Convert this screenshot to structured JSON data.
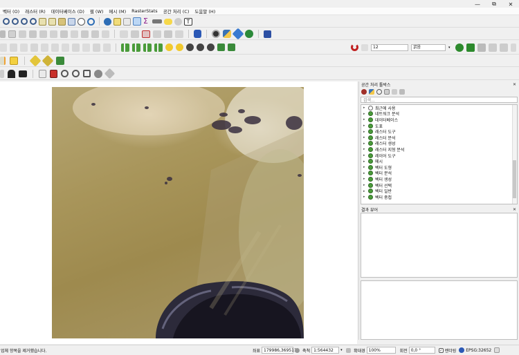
{
  "window": {
    "minimize": "—",
    "maximize": "⧉",
    "close": "✕"
  },
  "menu": [
    "벡터 (O)",
    "래스터 (R)",
    "데이터베이스 (D)",
    "웹 (W)",
    "메시 (M)",
    "RasterStats",
    "공간 처리 (C)",
    "도움말 (H)"
  ],
  "toolbar": {
    "font_size_value": "12",
    "font_style_value": "굵음"
  },
  "panel": {
    "toolbox_title": "공간 처리 툴박스",
    "search_placeholder": "검색...",
    "tree_items": [
      {
        "label": "최근에 사용",
        "icon": "clock-icon"
      },
      {
        "label": "네트워크 분석",
        "icon": "qgis-algorithm-icon"
      },
      {
        "label": "데이터베이스",
        "icon": "qgis-algorithm-icon"
      },
      {
        "label": "도표",
        "icon": "qgis-algorithm-icon"
      },
      {
        "label": "래스터 도구",
        "icon": "qgis-algorithm-icon"
      },
      {
        "label": "래스터 분석",
        "icon": "qgis-algorithm-icon"
      },
      {
        "label": "래스터 생성",
        "icon": "qgis-algorithm-icon"
      },
      {
        "label": "래스터 지형 분석",
        "icon": "qgis-algorithm-icon"
      },
      {
        "label": "레이어 도구",
        "icon": "qgis-algorithm-icon"
      },
      {
        "label": "메시",
        "icon": "qgis-algorithm-icon"
      },
      {
        "label": "벡터 도형",
        "icon": "qgis-algorithm-icon"
      },
      {
        "label": "벡터 분석",
        "icon": "qgis-algorithm-icon"
      },
      {
        "label": "벡터 생성",
        "icon": "qgis-algorithm-icon"
      },
      {
        "label": "벡터 선택",
        "icon": "qgis-algorithm-icon"
      },
      {
        "label": "벡터 일반",
        "icon": "qgis-algorithm-icon"
      },
      {
        "label": "벡터 중첩",
        "icon": "qgis-algorithm-icon"
      }
    ],
    "results_title": "결과 뷰어"
  },
  "status": {
    "message": "업체 항목을 제거했습니다.",
    "coord_label": "좌표",
    "coord_value": "179986,3695111",
    "scale_label": "축척",
    "scale_value": "1:564432",
    "magnifier_label": "확대경",
    "magnifier_value": "100%",
    "rotation_label": "회전",
    "rotation_value": "0,0 °",
    "render_label": "렌더링",
    "crs": "EPSG:32652"
  },
  "colors": {
    "accent": "#3c7a2c",
    "raster_base": "#a8955a",
    "rock": "#2c2a3a"
  }
}
